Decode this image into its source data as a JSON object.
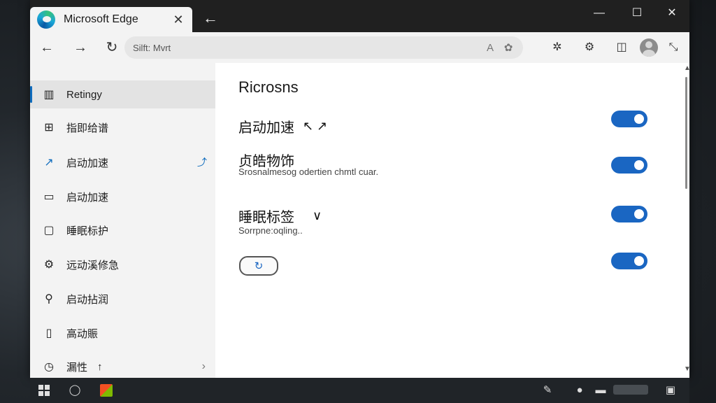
{
  "window": {
    "tab_title": "Microsoft Edge",
    "tab_close": "✕",
    "tb_back": "←",
    "minimize": "—",
    "maximize": "☐",
    "close": "✕"
  },
  "toolbar": {
    "back": "←",
    "forward": "→",
    "refresh": "↻",
    "address": "Silft: Mvrt",
    "addr_icon_1": "A",
    "addr_icon_2": "✿",
    "tool_1": "✲",
    "tool_2": "⚙",
    "tool_3": "◫",
    "tool_4": "⤡"
  },
  "sidebar": {
    "items": [
      {
        "icon": "▥",
        "label": "Retingy",
        "icon_name": "document-icon"
      },
      {
        "icon": "⊞",
        "label": "指即给谱",
        "icon_name": "grid-icon"
      },
      {
        "icon": "↗",
        "label": "启动加速",
        "icon_name": "trend-icon",
        "trail": "⤴"
      },
      {
        "icon": "▭",
        "label": "启动加速",
        "icon_name": "image-icon"
      },
      {
        "icon": "▢",
        "label": "睡眠标护",
        "icon_name": "square-icon"
      },
      {
        "icon": "⚙",
        "label": "远动溪修急",
        "icon_name": "gear-icon"
      },
      {
        "icon": "⚲",
        "label": "启动拈润",
        "icon_name": "search-icon"
      },
      {
        "icon": "▯",
        "label": "高动賑",
        "icon_name": "file-icon"
      },
      {
        "icon": "◷",
        "label": "漏性",
        "icon_name": "clock-icon",
        "trail": "↑",
        "chev": "›"
      }
    ]
  },
  "main": {
    "heading": "Ricrosns",
    "settings": [
      {
        "title": "启动加速",
        "aux": "↖ ↗",
        "desc": ""
      },
      {
        "title": "贞皓物饰",
        "aux": "",
        "desc": "Srosnalmesog odertien chmtl cuar."
      },
      {
        "title": "睡眠标签",
        "aux": "∨",
        "desc": "Sorrpne:oqling.."
      },
      {
        "title": "",
        "aux": "",
        "desc": ""
      }
    ],
    "small_button": "↻"
  },
  "taskbar": {
    "search": "◯",
    "tray_1": "✎",
    "tray_2": "●",
    "tray_3": "▬",
    "notification": "▣"
  },
  "colors": {
    "accent": "#1a66c2",
    "titlebar": "#202020"
  }
}
